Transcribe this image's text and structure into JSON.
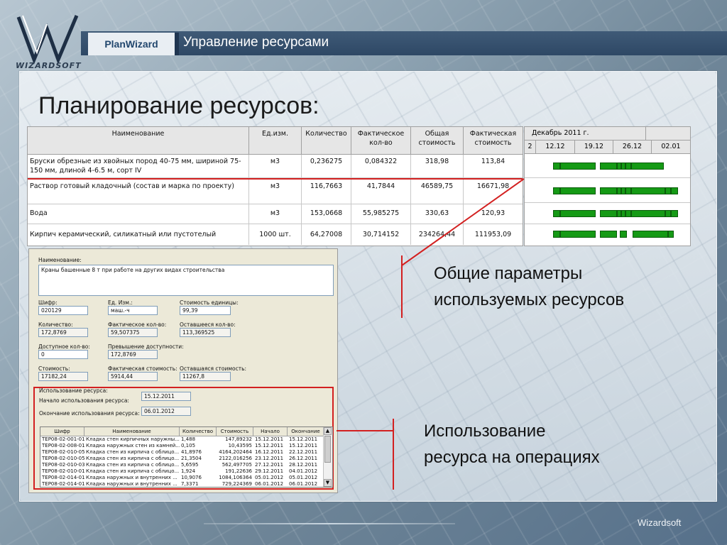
{
  "header": {
    "logo_text": "WIZARDSOFT",
    "brand": "PlanWizard",
    "title": "Управление ресурсами"
  },
  "slide": {
    "heading": "Планирование ресурсов:"
  },
  "resource_table": {
    "columns": [
      "Наименование",
      "Ед.изм.",
      "Количество",
      "Фактическое кол-во",
      "Общая стоимость",
      "Фактическая стоимость"
    ],
    "rows": [
      {
        "name": "Бруски обрезные из хвойных пород 40-75 мм, шириной 75-150 мм, длиной 4-6.5 м, сорт IV",
        "unit": "м3",
        "qty": "0,236275",
        "fact_qty": "0,084322",
        "total": "318,98",
        "fact_cost": "113,84"
      },
      {
        "name": "Раствор готовый кладочный (состав и марка по проекту)",
        "unit": "м3",
        "qty": "116,7663",
        "fact_qty": "41,7844",
        "total": "46589,75",
        "fact_cost": "16671,98"
      },
      {
        "name": "Вода",
        "unit": "м3",
        "qty": "153,0668",
        "fact_qty": "55,985275",
        "total": "330,63",
        "fact_cost": "120,93"
      },
      {
        "name": "Кирпич керамический, силикатный или пустотелый",
        "unit": "1000 шт.",
        "qty": "64,27008",
        "fact_qty": "30,714152",
        "total": "234264,44",
        "fact_cost": "111953,09"
      }
    ]
  },
  "gantt": {
    "month": "Декабрь 2011 г.",
    "weeks": [
      "2",
      "12.12",
      "19.12",
      "26.12",
      "02.01"
    ],
    "bar_color": "#159a15"
  },
  "form": {
    "name_label": "Наименование:",
    "name_value": "Краны башенные 8 т при работе на других видах строительства",
    "code_label": "Шифр:",
    "code_value": "020129",
    "unit_label": "Ед. Изм.:",
    "unit_value": "маш.-ч",
    "unit_cost_label": "Стоимость единицы:",
    "unit_cost_value": "99,39",
    "qty_label": "Количество:",
    "qty_value": "172,8769",
    "fact_qty_label": "Фактическое кол-во:",
    "fact_qty_value": "59,507375",
    "remain_qty_label": "Оставшееся кол-во:",
    "remain_qty_value": "113,369525",
    "avail_label": "Доступное кол-во:",
    "avail_value": "0",
    "excess_label": "Превышение доступности:",
    "excess_value": "172,8769",
    "cost_label": "Стоимость:",
    "cost_value": "17182,24",
    "fact_cost_label": "Фактическая стоимость:",
    "fact_cost_value": "5914,44",
    "remain_cost_label": "Оставшаяся стоимость:",
    "remain_cost_value": "11267,8",
    "usage_label": "Использование ресурса:",
    "start_label": "Начало использования ресурса:",
    "start_value": "15.12.2011",
    "end_label": "Окончание использования ресурса:",
    "end_value": "06.01.2012",
    "op_columns": [
      "Шифр",
      "Наименование",
      "Количество",
      "Стоимость",
      "Начало",
      "Окончание"
    ],
    "op_rows": [
      {
        "code": "ТЕР08-02-001-01",
        "name": "Кладка стен кирпичных наружны...",
        "qty": "1,488",
        "cost": "147,89232",
        "start": "15.12.2011",
        "end": "15.12.2011"
      },
      {
        "code": "ТЕР08-02-008-01",
        "name": "Кладка наружных стен из камней...",
        "qty": "0,105",
        "cost": "10,43595",
        "start": "15.12.2011",
        "end": "15.12.2011"
      },
      {
        "code": "ТЕР08-02-010-05",
        "name": "Кладка стен из кирпича с облицо...",
        "qty": "41,8976",
        "cost": "4164,202464",
        "start": "16.12.2011",
        "end": "22.12.2011"
      },
      {
        "code": "ТЕР08-02-010-05",
        "name": "Кладка стен из кирпича с облицо...",
        "qty": "21,3504",
        "cost": "2122,016256",
        "start": "23.12.2011",
        "end": "26.12.2011"
      },
      {
        "code": "ТЕР08-02-010-03",
        "name": "Кладка стен из кирпича с облицо...",
        "qty": "5,6595",
        "cost": "562,497705",
        "start": "27.12.2011",
        "end": "28.12.2011"
      },
      {
        "code": "ТЕР08-02-010-01",
        "name": "Кладка стен из кирпича с облицо...",
        "qty": "1,924",
        "cost": "191,22636",
        "start": "29.12.2011",
        "end": "04.01.2012"
      },
      {
        "code": "ТЕР08-02-014-01",
        "name": "Кладка наружных и внутренних ...",
        "qty": "10,9076",
        "cost": "1084,106364",
        "start": "05.01.2012",
        "end": "05.01.2012"
      },
      {
        "code": "ТЕР08-02-014-01",
        "name": "Кладка наружных и внутренних ...",
        "qty": "7,3371",
        "cost": "729,224369",
        "start": "06.01.2012",
        "end": "06.01.2012"
      }
    ]
  },
  "callouts": {
    "params_line1": "Общие параметры",
    "params_line2": "используемых ресурсов",
    "usage_line1": "Использование",
    "usage_line2": "ресурса на операциях"
  },
  "footer": {
    "brand": "Wizardsoft"
  },
  "colors": {
    "accent_red": "#d32020",
    "header_blue": "#2e4865"
  }
}
